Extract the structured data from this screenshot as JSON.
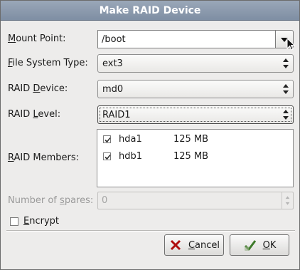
{
  "dialog": {
    "title": "Make RAID Device",
    "mount_point": {
      "label_pre": "",
      "label_mnemonic": "M",
      "label_post": "ount Point:",
      "value": "/boot"
    },
    "fs_type": {
      "label_pre": "",
      "label_mnemonic": "F",
      "label_post": "ile System Type:",
      "value": "ext3"
    },
    "raid_device": {
      "label_pre": "RAID ",
      "label_mnemonic": "D",
      "label_post": "evice:",
      "value": "md0"
    },
    "raid_level": {
      "label_pre": "RAID ",
      "label_mnemonic": "L",
      "label_post": "evel:",
      "value": "RAID1"
    },
    "raid_members": {
      "label_pre": "",
      "label_mnemonic": "R",
      "label_post": "AID Members:",
      "items": [
        {
          "name": "hda1",
          "size": "125 MB",
          "checked": true
        },
        {
          "name": "hdb1",
          "size": "125 MB",
          "checked": true
        }
      ]
    },
    "spares": {
      "label_pre": "Number of ",
      "label_mnemonic": "s",
      "label_post": "pares:",
      "value": "0"
    },
    "encrypt": {
      "label_pre": "",
      "label_mnemonic": "E",
      "label_post": "ncrypt",
      "checked": false
    },
    "buttons": {
      "cancel": {
        "label_pre": "",
        "label_mnemonic": "C",
        "label_post": "ancel"
      },
      "ok": {
        "label_pre": "",
        "label_mnemonic": "O",
        "label_post": "K"
      }
    }
  },
  "icons": {
    "dropdown": "chevron-down-icon",
    "spinner": "up-down-arrows-icon",
    "cancel": "cancel-x-icon",
    "ok": "ok-hand-check-icon",
    "cursor": "mouse-pointer-icon"
  },
  "colors": {
    "titlebar": "#8796aa",
    "dialog_bg": "#edeceb",
    "cancel_icon": "#b01010",
    "ok_icon": "#3d7a2a"
  }
}
